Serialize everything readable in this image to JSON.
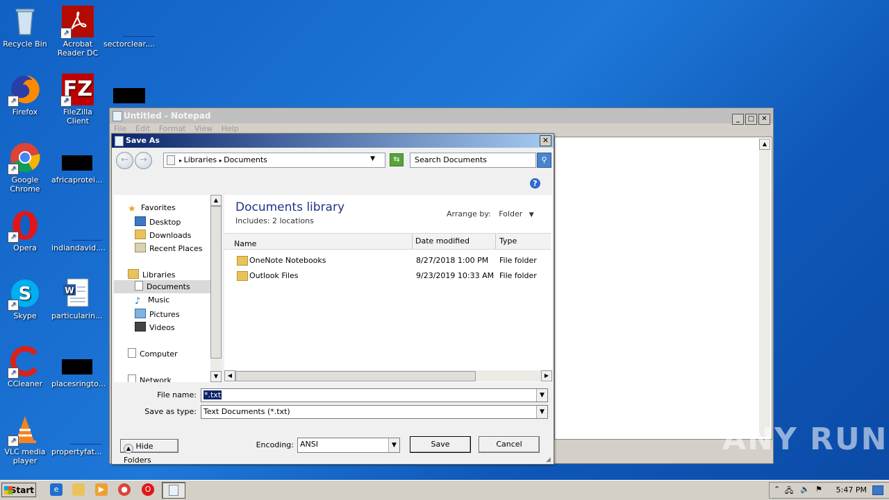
{
  "desktop": {
    "icons": [
      {
        "label": "Recycle Bin"
      },
      {
        "label": "Acrobat Reader DC"
      },
      {
        "label": "sectorclear...."
      },
      {
        "label": "Firefox"
      },
      {
        "label": "FileZilla Client"
      },
      {
        "label": "Google Chrome"
      },
      {
        "label": "africaprotei..."
      },
      {
        "label": "Opera"
      },
      {
        "label": "indiandavid...."
      },
      {
        "label": "Skype"
      },
      {
        "label": "particularin..."
      },
      {
        "label": "CCleaner"
      },
      {
        "label": "placesringto..."
      },
      {
        "label": "VLC media player"
      },
      {
        "label": "propertyfat..."
      }
    ]
  },
  "notepad": {
    "title": "Untitled - Notepad",
    "menu": [
      "File",
      "Edit",
      "Format",
      "View",
      "Help"
    ]
  },
  "dialog": {
    "title": "Save As",
    "breadcrumb": [
      "Libraries",
      "Documents"
    ],
    "search_placeholder": "Search Documents",
    "nav": {
      "favorites": "Favorites",
      "desktop": "Desktop",
      "downloads": "Downloads",
      "recent": "Recent Places",
      "libraries": "Libraries",
      "documents": "Documents",
      "music": "Music",
      "pictures": "Pictures",
      "videos": "Videos",
      "computer": "Computer",
      "network": "Network"
    },
    "library_title": "Documents library",
    "library_sub": "Includes:  2 locations",
    "arrange_label": "Arrange by:",
    "arrange_value": "Folder",
    "columns": {
      "name": "Name",
      "date": "Date modified",
      "type": "Type"
    },
    "files": [
      {
        "name": "OneNote Notebooks",
        "date": "8/27/2018 1:00 PM",
        "type": "File folder"
      },
      {
        "name": "Outlook Files",
        "date": "9/23/2019 10:33 AM",
        "type": "File folder"
      }
    ],
    "file_name_label": "File name:",
    "file_name_value": "*.txt",
    "save_type_label": "Save as type:",
    "save_type_value": "Text Documents (*.txt)",
    "hide_folders": "Hide Folders",
    "encoding_label": "Encoding:",
    "encoding_value": "ANSI",
    "save": "Save",
    "cancel": "Cancel"
  },
  "taskbar": {
    "start": "Start",
    "clock": "5:47 PM"
  },
  "watermark": "ANY RUN"
}
